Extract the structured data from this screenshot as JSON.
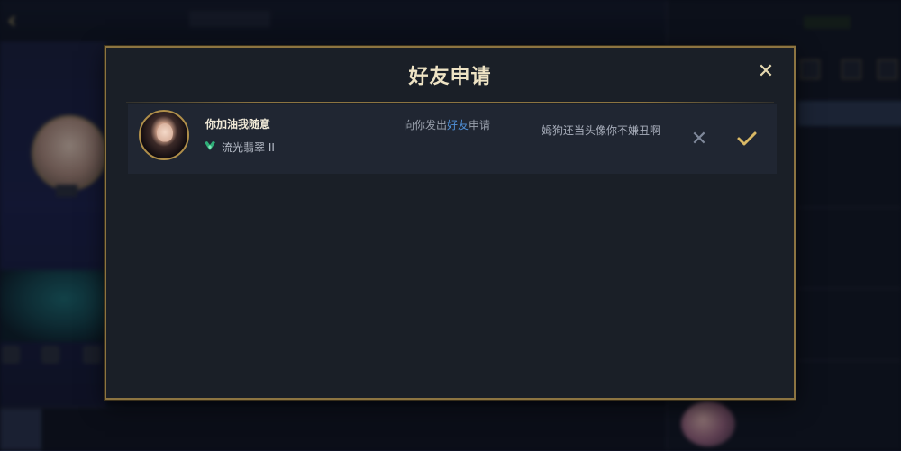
{
  "modal": {
    "title": "好友申请",
    "close_icon": "close-icon",
    "requests": [
      {
        "name": "你加油我随意",
        "rank": "流光翡翠 II",
        "rank_icon": "emerald-rank-icon",
        "action_prefix": "向你发出",
        "action_highlight": "好友",
        "action_suffix": "申请",
        "message": "姆狗还当头像你不嫌丑啊",
        "reject_icon": "reject-x-icon",
        "accept_icon": "accept-check-icon"
      }
    ]
  },
  "colors": {
    "gold_border": "#8c7441",
    "modal_bg": "#1a1f27",
    "row_bg": "#202632",
    "highlight_blue": "#4f8fd6",
    "accept_gold": "#d9b865"
  }
}
